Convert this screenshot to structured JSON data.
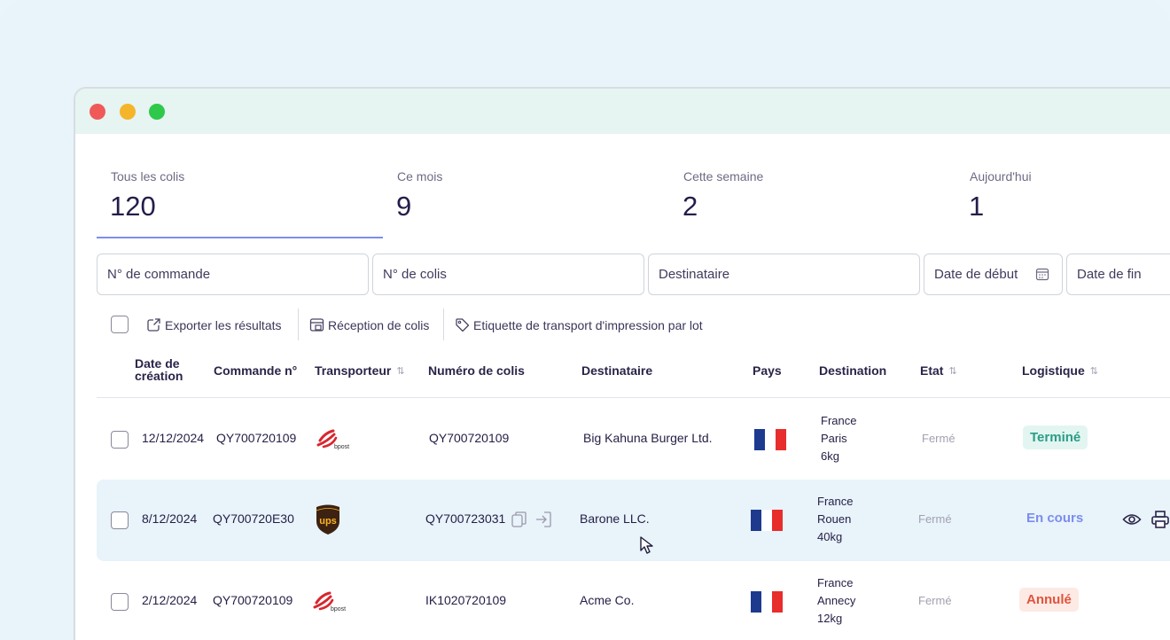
{
  "colors": {
    "accent": "#7b8df0",
    "badge_done_bg": "#e3f5f1",
    "badge_done_fg": "#2a9d86",
    "badge_progress_fg": "#7b8df0",
    "badge_cancel_bg": "#fdeae5",
    "badge_cancel_fg": "#e0543b"
  },
  "stats": [
    {
      "label": "Tous les colis",
      "value": "120"
    },
    {
      "label": "Ce mois",
      "value": "9"
    },
    {
      "label": "Cette semaine",
      "value": "2"
    },
    {
      "label": "Aujourd'hui",
      "value": "1"
    }
  ],
  "filters": {
    "order_no": "N° de commande",
    "parcel_no": "N° de colis",
    "recipient": "Destinataire",
    "start_date": "Date de début",
    "end_date": "Date de fin"
  },
  "toolbar": {
    "export": "Exporter les résultats",
    "reception": "Réception de colis",
    "batch_label": "Etiquette de transport d'impression par lot"
  },
  "table": {
    "headers": {
      "created_line1": "Date de",
      "created_line2": "création",
      "order": "Commande n°",
      "carrier": "Transporteur",
      "parcel": "Numéro de colis",
      "recipient": "Destinataire",
      "country": "Pays",
      "destination": "Destination",
      "state": "Etat",
      "logistics": "Logistique",
      "sort_glyph": "⇅"
    },
    "rows": [
      {
        "date": "12/12/2024",
        "order": "QY700720109",
        "carrier": "bpost",
        "carrier_text": "bpost",
        "parcel": "QY700720109",
        "recipient": "Big Kahuna Burger Ltd.",
        "country_icon": "france-flag",
        "dest_country": "France",
        "dest_city": "Paris",
        "weight": "6kg",
        "state": "Fermé",
        "logistics": "Terminé"
      },
      {
        "date": "8/12/2024",
        "order": "QY700720E30",
        "carrier": "ups",
        "carrier_text": "ups",
        "parcel": "QY700723031",
        "recipient": "Barone LLC.",
        "country_icon": "france-flag",
        "dest_country": "France",
        "dest_city": "Rouen",
        "weight": "40kg",
        "state": "Fermé",
        "logistics": "En cours"
      },
      {
        "date": "2/12/2024",
        "order": "QY700720109",
        "carrier": "bpost",
        "carrier_text": "bpost",
        "parcel": "IK1020720109",
        "recipient": "Acme Co.",
        "country_icon": "france-flag",
        "dest_country": "France",
        "dest_city": "Annecy",
        "weight": "12kg",
        "state": "Fermé",
        "logistics": "Annulé"
      }
    ]
  }
}
